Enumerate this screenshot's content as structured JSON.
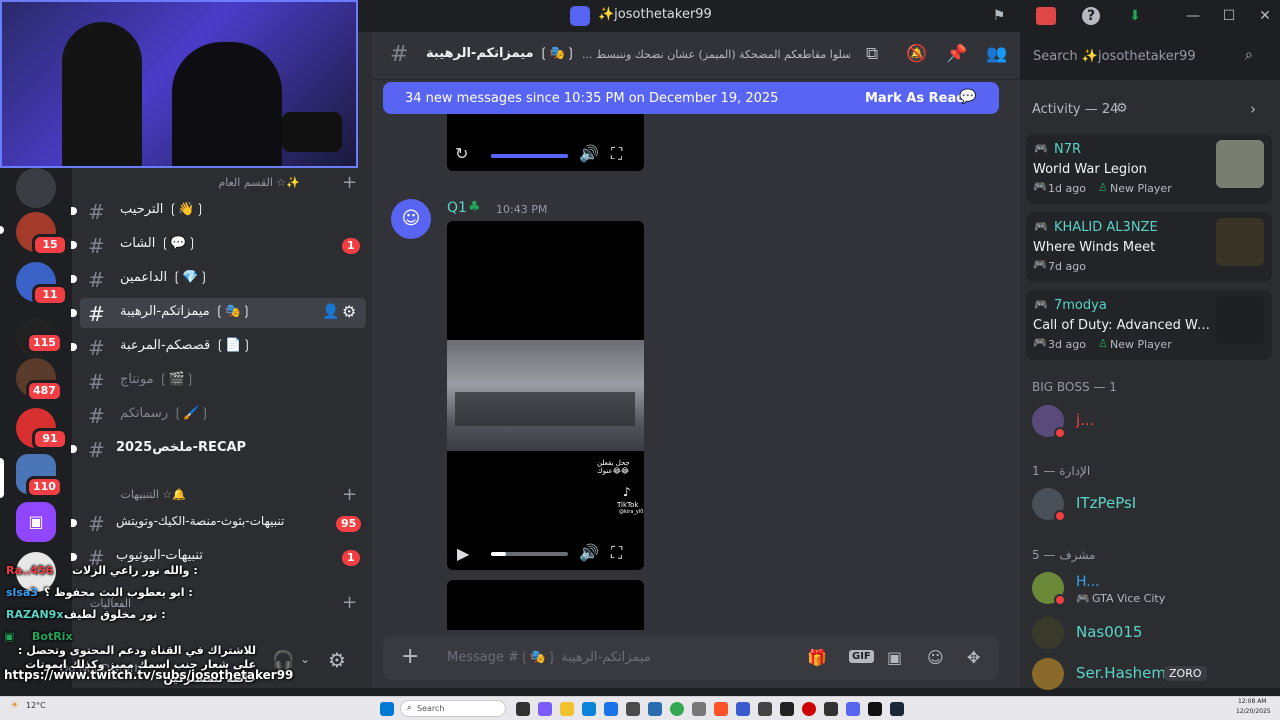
{
  "window": {
    "title": "✨josothetaker99"
  },
  "channel_sidebar": {
    "category_general": "القسم العام ☆✨",
    "category_alerts": "التنبيهات ☆🔔",
    "category_events": "الفعاليات",
    "channels": [
      {
        "name": "الترحيب ❲👋❳",
        "unread": true
      },
      {
        "name": "الشات ❲💬❳",
        "unread": true,
        "mentions": "1"
      },
      {
        "name": "الداعمين ❲💎❳",
        "unread": true
      },
      {
        "name": "ميمزاتكم-الرهيبة ❲🎭❳",
        "active": true
      },
      {
        "name": "قصصكم-المرعبة ❲📄❳",
        "unread": true
      },
      {
        "name": "مونتاج ❲🎬❳",
        "unread": false
      },
      {
        "name": "رسماتكم ❲🖌️❳",
        "unread": false
      },
      {
        "name": "ملخص2025-RECAP",
        "unread": true
      },
      {
        "name": "تنبيهات-بثوث-منصة-الكيك-وتويتش",
        "unread": true,
        "mentions": "95"
      },
      {
        "name": "تنبيهات-اليوتيوب",
        "unread": true,
        "mentions": "1"
      }
    ],
    "user_status": "Do Not Disturb"
  },
  "server_rail": {
    "badges": [
      "15",
      "11",
      "115",
      "487",
      "91",
      "110"
    ]
  },
  "chat_header": {
    "channel_name": "ميمزاتكم-الرهيبة ❲🎭❳",
    "topic": "... ارسلوا مقاطعكم المضحكة (الميمز) عشان نضحك وننبسط",
    "search_placeholder": "Search ✨josothetaker99"
  },
  "new_messages_bar": {
    "text": "34 new messages since 10:35 PM on December 19, 2025",
    "action": "Mark As Read"
  },
  "messages": [
    {
      "author": "Q1",
      "time": "10:43 PM",
      "video_caption": "جحل يقعلن عنوك😂😂",
      "tiktok_label": "TikTok",
      "tiktok_handle": "@kira_yl0"
    }
  ],
  "composer": {
    "placeholder": "Message #❲🎭❳ ميمزاتكم-الرهيبة"
  },
  "activity": {
    "header": "Activity — 24",
    "cards": [
      {
        "user": "N7R",
        "game": "World War Legion",
        "time": "1d ago",
        "tag": "New Player"
      },
      {
        "user": "KHALID AL3NZE",
        "game": "Where Winds Meet",
        "time": "7d ago",
        "tag": ""
      },
      {
        "user": "7modya",
        "game": "Call of Duty: Advanced Wa...",
        "time": "3d ago",
        "tag": "New Player"
      }
    ]
  },
  "members": {
    "sections": [
      {
        "title": "BIG BOSS — 1",
        "members": [
          {
            "name": "j...",
            "color": "#f23f43",
            "status": ""
          }
        ]
      },
      {
        "title": "الإدارة — 1",
        "members": [
          {
            "name": "ITzPePsI",
            "color": "#5ad4c6",
            "status": ""
          }
        ]
      },
      {
        "title": "مشرف — 5",
        "members": [
          {
            "name": "H...",
            "color": "#3ba3f2",
            "status": "GTA Vice City"
          },
          {
            "name": "Nas0015",
            "color": "#5ad4c6",
            "status": ""
          },
          {
            "name": "Ser.Hashem",
            "color": "#5ad4c6",
            "status": "",
            "tag": "ZORO"
          }
        ]
      }
    ]
  },
  "stream_chat": [
    {
      "user": "Ra..456",
      "text": "والله نور راعي الزلات :"
    },
    {
      "user": "slsa3",
      "text": "ابو يعطوب البث محفوظ ؟ :"
    },
    {
      "user": "RAZAN9x",
      "text": "نور مخلوق لطيف :"
    },
    {
      "user": "BotRix",
      "text": "للاشتراك في القناة ودعم المحتوى وتحصل : على شعار جنب اسمك مميز وكذلك ايموتات خاصة للمشتركين"
    },
    {
      "user": "",
      "text": "https://www.twitch.tv/subs/josothetaker99"
    }
  ],
  "taskbar": {
    "weather": "12°C",
    "search": "Search",
    "time": "12:08 AM",
    "date": "12/20/2025"
  },
  "colors": {
    "blurple": "#5865f2",
    "red": "#f23f43",
    "teal": "#5ad4c6",
    "bg_dark": "#1e1f22",
    "bg_chat": "#313338"
  }
}
